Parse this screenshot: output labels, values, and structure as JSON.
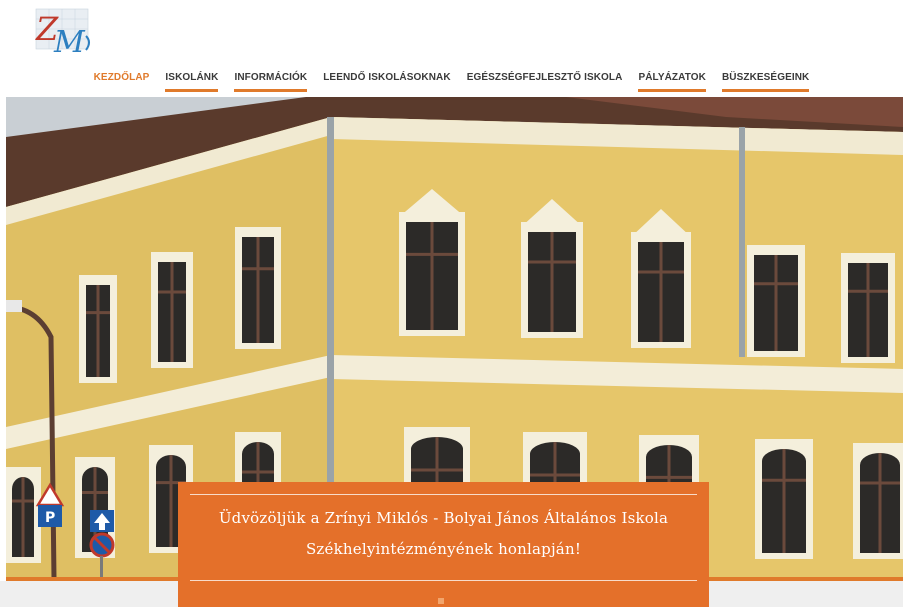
{
  "logo": {
    "text_z": "Z",
    "text_m": "M"
  },
  "nav": {
    "items": [
      {
        "label": "KEZDŐLAP",
        "active": true,
        "underline": false
      },
      {
        "label": "ISKOLÁNK",
        "active": false,
        "underline": true
      },
      {
        "label": "INFORMÁCIÓK",
        "active": false,
        "underline": true
      },
      {
        "label": "LEENDŐ ISKOLÁSOKNAK",
        "active": false,
        "underline": false
      },
      {
        "label": "EGÉSZSÉGFEJLESZTŐ ISKOLA",
        "active": false,
        "underline": false
      },
      {
        "label": "PÁLYÁZATOK",
        "active": false,
        "underline": true
      },
      {
        "label": "BÜSZKESÉGEINK",
        "active": false,
        "underline": true
      }
    ]
  },
  "hero": {
    "caption_line1": "Üdvözöljük a Zrínyi Miklós - Bolyai János Általános Iskola",
    "caption_line2": "Székhelyintézményének honlapján!"
  },
  "colors": {
    "accent": "#e07a2b",
    "caption_bg": "#e4702a",
    "wall": "#e6c66a"
  }
}
